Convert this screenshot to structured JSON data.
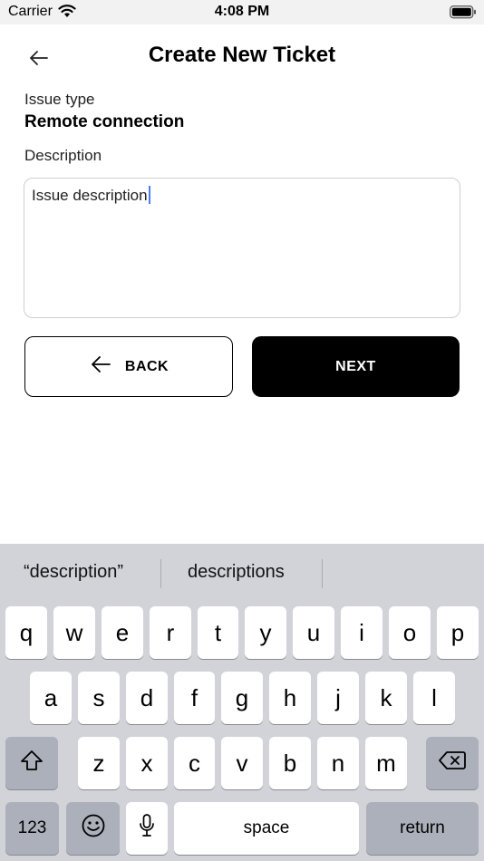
{
  "status_bar": {
    "carrier": "Carrier",
    "time": "4:08 PM"
  },
  "header": {
    "title": "Create New Ticket"
  },
  "form": {
    "issue_type_label": "Issue type",
    "issue_type_value": "Remote connection",
    "description_label": "Description",
    "description_value": "Issue description"
  },
  "buttons": {
    "back_label": "BACK",
    "next_label": "NEXT"
  },
  "keyboard": {
    "suggestions": [
      "“description”",
      "descriptions"
    ],
    "row1": [
      "q",
      "w",
      "e",
      "r",
      "t",
      "y",
      "u",
      "i",
      "o",
      "p"
    ],
    "row2": [
      "a",
      "s",
      "d",
      "f",
      "g",
      "h",
      "j",
      "k",
      "l"
    ],
    "row3": [
      "z",
      "x",
      "c",
      "v",
      "b",
      "n",
      "m"
    ],
    "numbers_key": "123",
    "space_key": "space",
    "return_key": "return",
    "shift_icon": "shift-icon",
    "delete_icon": "delete-icon",
    "emoji_icon": "emoji-icon",
    "mic_icon": "microphone-icon"
  },
  "colors": {
    "caret": "#4a7cf7",
    "keyboard_bg": "#d1d3d9",
    "special_key": "#abb0ba"
  }
}
